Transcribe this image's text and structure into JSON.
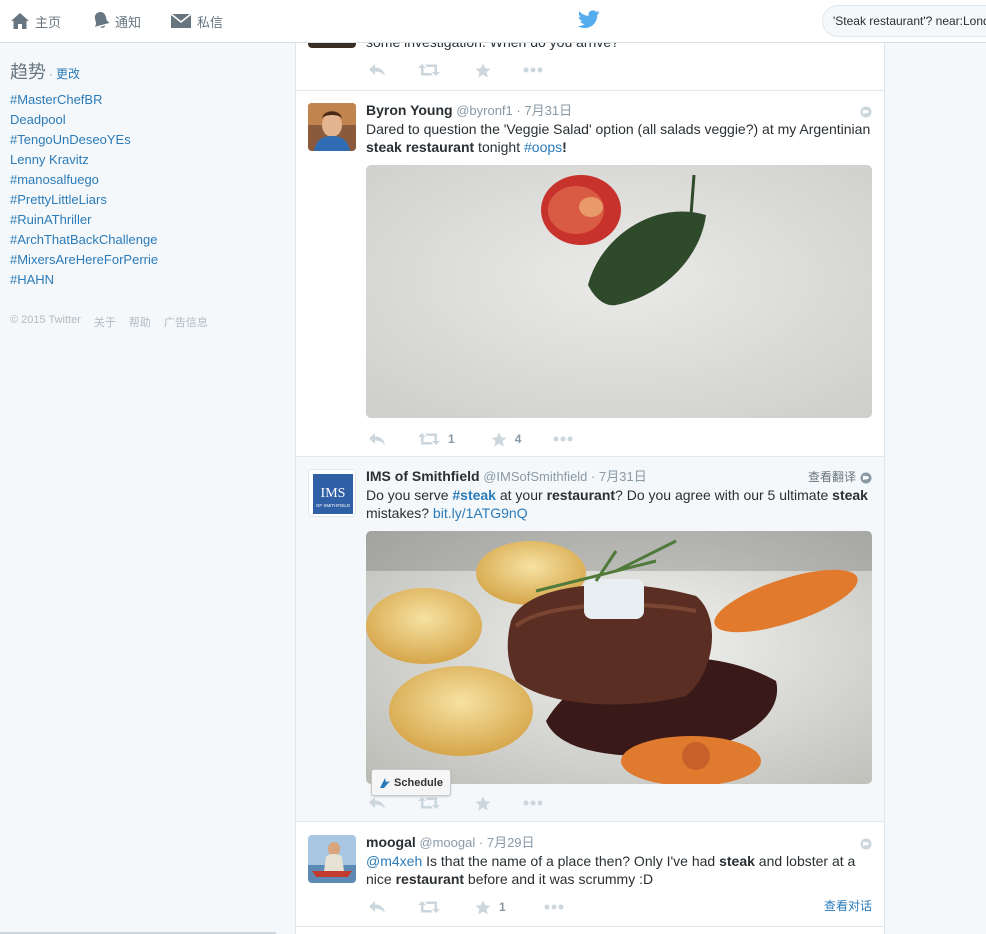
{
  "nav": {
    "home_label": "主页",
    "notifications_label": "通知",
    "messages_label": "私信",
    "logo_icon": "twitter-bird-icon",
    "search_value": "'Steak restaurant'? near:London"
  },
  "trends": {
    "title": "趋势",
    "dot": "·",
    "change_label": "更改",
    "items": [
      "#MasterChefBR",
      "Deadpool",
      "#TengoUnDeseoYEs",
      "Lenny Kravitz",
      "#manosalfuego",
      "#PrettyLittleLiars",
      "#RuinAThriller",
      "#ArchThatBackChallenge",
      "#MixersAreHereForPerrie",
      "#HAHN"
    ]
  },
  "footer": {
    "copyright": "© 2015 Twitter",
    "about": "关于",
    "help": "帮助",
    "ads": "广告信息"
  },
  "tweets": [
    {
      "text": "some investigation. When do you arrive?"
    },
    {
      "fullname": "Byron Young",
      "username": "@byronf1",
      "sep": "·",
      "time": "7月31日",
      "text_1": "Dared to question the 'Veggie Salad' option (all salads veggie?) at my Argentinian ",
      "text_b1": "steak restaurant",
      "text_2": " tonight ",
      "text_link": "#oops",
      "text_3": "!",
      "retweets": "1",
      "favorites": "4"
    },
    {
      "fullname": "IMS of Smithfield",
      "username": "@IMSofSmithfield",
      "sep": "·",
      "time": "7月31日",
      "translate": "查看翻译",
      "text_1": "Do you serve ",
      "text_link1": "#steak",
      "text_2": " at your ",
      "text_b1": "restaurant",
      "text_3": "? Do you agree with our 5 ultimate ",
      "text_b2": "steak",
      "text_4": " mistakes? ",
      "text_link2": "bit.ly/1ATG9nQ",
      "avatar_text": "IMS",
      "avatar_sub": "OF SMITHFIELD",
      "schedule_label": "Schedule"
    },
    {
      "fullname": "moogal",
      "username": "@moogal",
      "sep": "·",
      "time": "7月29日",
      "text_link": "@m4xeh",
      "text_1": " Is that the name of a place then? Only I've had ",
      "text_b1": "steak",
      "text_2": " and lobster at a nice ",
      "text_b2": "restaurant",
      "text_3": " before and it was scrummy :D",
      "favorites": "1",
      "conversation_link": "查看对话"
    }
  ]
}
